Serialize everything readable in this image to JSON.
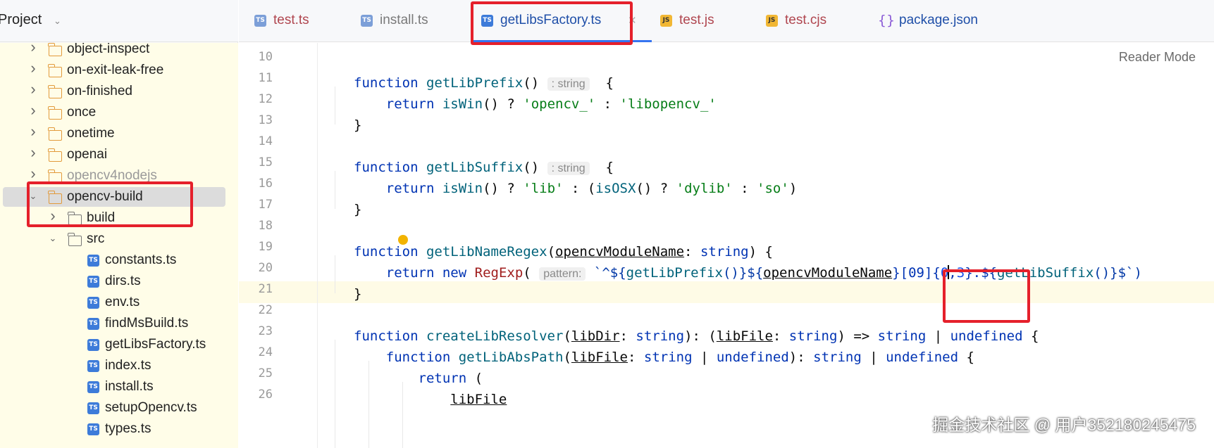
{
  "sidebar": {
    "title": "Project",
    "tree": [
      {
        "label": "object-inspect",
        "type": "folder",
        "state": "collapsed"
      },
      {
        "label": "on-exit-leak-free",
        "type": "folder",
        "state": "collapsed"
      },
      {
        "label": "on-finished",
        "type": "folder",
        "state": "collapsed"
      },
      {
        "label": "once",
        "type": "folder",
        "state": "collapsed"
      },
      {
        "label": "onetime",
        "type": "folder",
        "state": "collapsed"
      },
      {
        "label": "openai",
        "type": "folder",
        "state": "collapsed"
      },
      {
        "label": "opencv4nodejs",
        "type": "folder",
        "state": "collapsed"
      },
      {
        "label": "opencv-build",
        "type": "folder",
        "state": "expanded",
        "selected": true
      },
      {
        "label": "build",
        "type": "folder-plain",
        "state": "collapsed"
      },
      {
        "label": "src",
        "type": "folder-plain",
        "state": "expanded"
      },
      {
        "label": "constants.ts",
        "type": "ts-file"
      },
      {
        "label": "dirs.ts",
        "type": "ts-file"
      },
      {
        "label": "env.ts",
        "type": "ts-file"
      },
      {
        "label": "findMsBuild.ts",
        "type": "ts-file"
      },
      {
        "label": "getLibsFactory.ts",
        "type": "ts-file"
      },
      {
        "label": "index.ts",
        "type": "ts-file"
      },
      {
        "label": "install.ts",
        "type": "ts-file"
      },
      {
        "label": "setupOpencv.ts",
        "type": "ts-file"
      },
      {
        "label": "types.ts",
        "type": "ts-file"
      }
    ]
  },
  "tabs": [
    {
      "label": "test.ts",
      "icon": "TS",
      "color": "#b0464f"
    },
    {
      "label": "install.ts",
      "icon": "TS",
      "color": "#7a7a7a"
    },
    {
      "label": "getLibsFactory.ts",
      "icon": "TS",
      "color": "#1f4fa8",
      "active": true
    },
    {
      "label": "test.js",
      "icon": "JS",
      "color": "#b0464f"
    },
    {
      "label": "test.cjs",
      "icon": "JS",
      "color": "#b0464f"
    },
    {
      "label": "package.json",
      "icon": "{}",
      "color": "#1f4fa8"
    }
  ],
  "editor": {
    "reader_mode": "Reader Mode",
    "line_numbers": [
      "10",
      "11",
      "12",
      "13",
      "14",
      "15",
      "16",
      "17",
      "18",
      "19",
      "20",
      "21",
      "22",
      "23",
      "24",
      "25",
      "26"
    ],
    "current_line": "20",
    "lines": {
      "l11": {
        "kw": "function",
        "fn": "getLibPrefix",
        "paren": "()",
        "hint": ": string",
        "brace": "{"
      },
      "l12": {
        "kw": "return",
        "fn": "isWin",
        "rest": "() ? ",
        "s1": "'opencv_'",
        "mid": " : ",
        "s2": "'libopencv_'"
      },
      "l13": {
        "text": "}"
      },
      "l15": {
        "kw": "function",
        "fn": "getLibSuffix",
        "paren": "()",
        "hint": ": string",
        "brace": "{"
      },
      "l16": {
        "kw": "return",
        "fn": "isWin",
        "rest": "() ? ",
        "s1": "'lib'",
        "mid": " : (",
        "fn2": "isOSX",
        "rest2": "() ? ",
        "s2": "'dylib'",
        "mid2": " : ",
        "s3": "'so'",
        "end": ")"
      },
      "l17": {
        "text": "}"
      },
      "l19": {
        "kw": "function",
        "fn": "getLibNameRegex",
        "open": "(",
        "param": "opencvModuleName",
        "colon": ": ",
        "type": "string",
        "close": ") {"
      },
      "l20": {
        "kw1": "return",
        "kw2": "new",
        "cls": "RegExp",
        "open": "(",
        "hint": "pattern:",
        "t1": "`^${",
        "f1": "getLibPrefix",
        "t2": "()}${",
        "p1": "opencvModuleName",
        "t3": "}[0",
        "t4": "9]{",
        "n1": "0",
        "t5": ",",
        "n2": "3",
        "t6": "}.$",
        "t7": "{",
        "f2": "getLibSuffix",
        "t8": "()}$`)"
      },
      "l21": {
        "text": "}"
      },
      "l23": {
        "kw": "function",
        "fn": "createLibResolver",
        "open": "(",
        "p1": "libDir",
        "c1": ": ",
        "t1": "string",
        "mid": "): (",
        "p2": "libFile",
        "c2": ": ",
        "t2": "string",
        "arrow": ") => ",
        "t3": "string",
        "pipe": " | ",
        "t4": "undefined",
        "brace": " {"
      },
      "l24": {
        "kw": "function",
        "fn": "getLibAbsPath",
        "open": "(",
        "p1": "libFile",
        "c1": ": ",
        "t1": "string",
        "pipe": " | ",
        "t2": "undefined",
        "mid": "): ",
        "t3": "string",
        "pipe2": " | ",
        "t4": "undefined",
        "brace": " {"
      },
      "l25": {
        "kw": "return",
        "rest": " ("
      },
      "l26": {
        "param": "libFile"
      }
    }
  },
  "watermark": "掘金技术社区 @ 用户352180245475",
  "colors": {
    "annotation": "#e5202b",
    "accent": "#3574f0"
  }
}
